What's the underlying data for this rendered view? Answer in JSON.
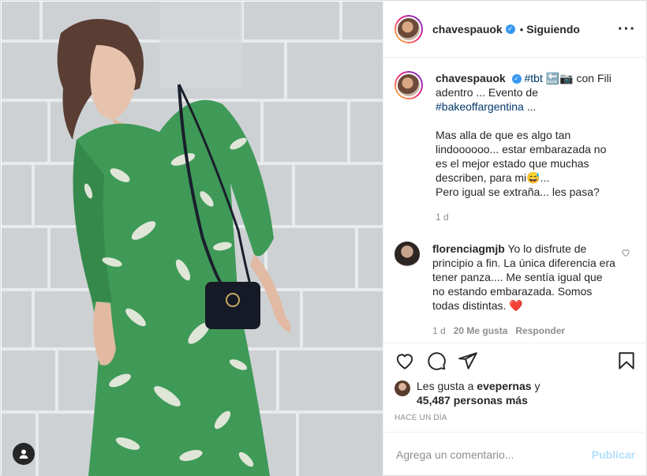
{
  "post": {
    "image_alt": "Mujer con vestido verde floral junto a pared de bloques",
    "user_tag_icon": "user-icon"
  },
  "header": {
    "username": "chavespauok",
    "verified": true,
    "separator": "•",
    "follow_status": "Siguiendo",
    "more_icon": "more-options-icon"
  },
  "caption": {
    "username": "chavespauok",
    "hashtag_tbt": "#tbt",
    "text_1": " 🔙📷 con Fili adentro ... Evento de ",
    "hashtag_bake": "#bakeoffargentina",
    "text_2": " ...",
    "paragraph_2": "Mas alla de que es algo tan lindoooooo... estar embarazada no es el mejor estado que muchas describen, para mi😅...",
    "paragraph_3": "Pero igual se extraña... les pasa?",
    "age": "1 d"
  },
  "comment": {
    "username": "florenciagmjb",
    "text": "Yo lo disfrute de principio a fin. La única diferencia era tener panza.... Me sentía igual que no estando embarazada. Somos todas distintas. ",
    "emoji": "❤️",
    "age": "1 d",
    "likes": "20 Me gusta",
    "reply": "Responder"
  },
  "actions": {
    "like_icon": "heart-icon",
    "comment_icon": "comment-icon",
    "share_icon": "share-icon",
    "save_icon": "bookmark-icon"
  },
  "likes": {
    "prefix": "Les gusta a ",
    "user": "evepernas",
    "middle": " y ",
    "count": "45,487 personas más"
  },
  "timestamp": "HACE UN DÍA",
  "add_comment": {
    "placeholder": "Agrega un comentario...",
    "post_label": "Publicar"
  },
  "colors": {
    "link": "#00376b",
    "verified": "#3897f0",
    "muted": "#8e8e8e",
    "publish_disabled": "#b2dffc",
    "heart_red": "#ed4956"
  }
}
